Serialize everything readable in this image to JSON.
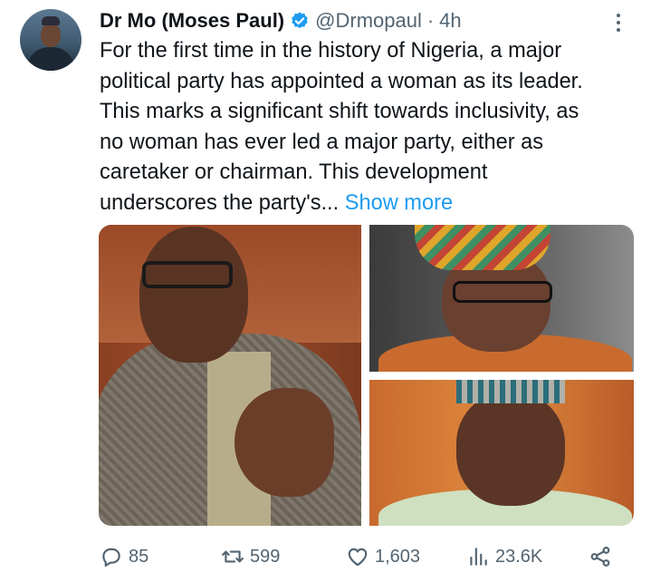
{
  "author": {
    "name": "Dr Mo (Moses Paul)",
    "handle": "@Drmopaul",
    "separator": "·",
    "time": "4h",
    "verified": true
  },
  "tweet": {
    "lines": [
      "For the first time in the history of Nigeria, a major",
      "political party has appointed a woman as its leader.",
      "This marks a significant shift towards inclusivity, as",
      "no woman has ever led a major party, either as",
      "caretaker or chairman. This development"
    ],
    "last_line": "underscores the party's...",
    "show_more": "Show more"
  },
  "media": [
    {
      "name": "photo-man-glasses-gesturing"
    },
    {
      "name": "photo-woman-headwrap-glasses"
    },
    {
      "name": "photo-man-cap-smiling"
    }
  ],
  "actions": {
    "replies": "85",
    "retweets": "599",
    "likes": "1,603",
    "views": "23.6K"
  },
  "colors": {
    "text": "#0f1419",
    "secondary": "#536471",
    "accent": "#1d9bf0"
  },
  "icons": [
    "verified-badge-icon",
    "more-options-icon",
    "reply-icon",
    "retweet-icon",
    "like-icon",
    "views-icon",
    "share-icon"
  ]
}
